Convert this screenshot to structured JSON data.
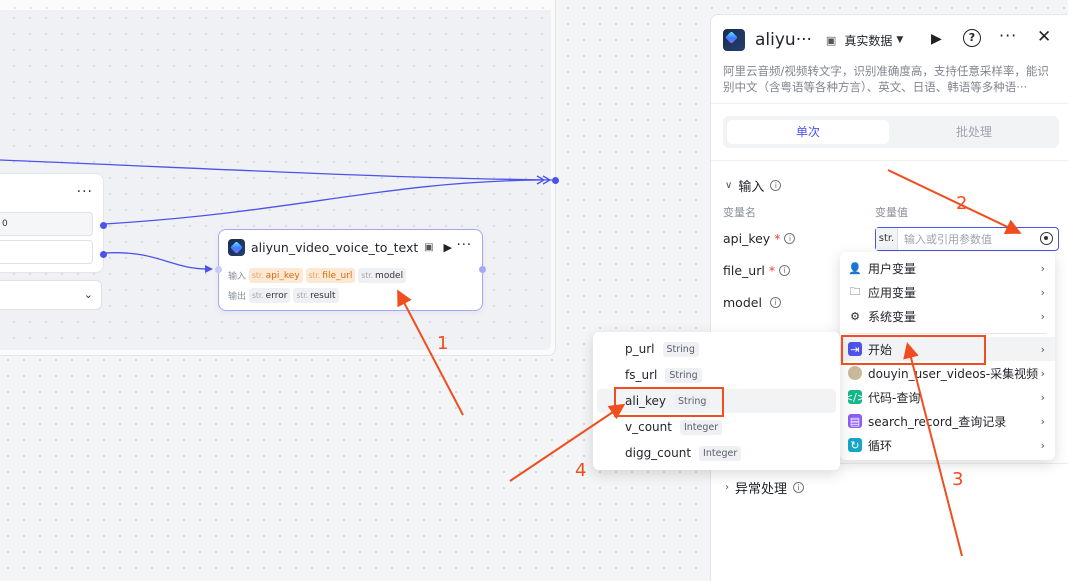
{
  "canvas": {
    "prev_node": {
      "field1_value": "0"
    },
    "main_node": {
      "title": "aliyun_video_voice_to_text",
      "input_label": "输入",
      "output_label": "输出",
      "type_prefix": "str.",
      "inputs": [
        "api_key",
        "file_url",
        "model"
      ],
      "outputs": [
        "error",
        "result"
      ]
    }
  },
  "panel": {
    "title": "aliyu···",
    "mode": "真实数据",
    "description": "阿里云音频/视频转文字，识别准确度高，支持任意采样率，能识别中文（含粤语等各种方言）、英文、日语、韩语等多种语···",
    "tabs": {
      "single": "单次",
      "batch": "批处理"
    },
    "input_section": "输入",
    "col_name": "变量名",
    "col_value": "变量值",
    "variables": [
      {
        "name": "api_key",
        "required": "*"
      },
      {
        "name": "file_url",
        "required": "*"
      },
      {
        "name": "model",
        "required": ""
      }
    ],
    "value_type": "str.",
    "value_placeholder": "输入或引用参数值",
    "error_section": "异常处理"
  },
  "dropdown_sources": {
    "items": [
      {
        "label": "用户变量",
        "icon": "user-icon"
      },
      {
        "label": "应用变量",
        "icon": "folder-icon"
      },
      {
        "label": "系统变量",
        "icon": "gear-icon"
      },
      {
        "label": "开始",
        "icon": "start-icon"
      },
      {
        "label": "douyin_user_videos-采集视频",
        "icon": "avatar-icon"
      },
      {
        "label": "代码-查询",
        "icon": "code-icon"
      },
      {
        "label": "search_record_查询记录",
        "icon": "database-icon"
      },
      {
        "label": "循环",
        "icon": "loop-icon"
      }
    ]
  },
  "dropdown_fields": {
    "items": [
      {
        "name": "p_url",
        "type": "String"
      },
      {
        "name": "fs_url",
        "type": "String"
      },
      {
        "name": "ali_key",
        "type": "String"
      },
      {
        "name": "v_count",
        "type": "Integer"
      },
      {
        "name": "digg_count",
        "type": "Integer"
      }
    ]
  },
  "annotations": [
    "1",
    "2",
    "3",
    "4"
  ],
  "colors": {
    "accent": "#4d53e8",
    "annotation": "#f04e1f",
    "warn_chip": "#d46b08"
  }
}
